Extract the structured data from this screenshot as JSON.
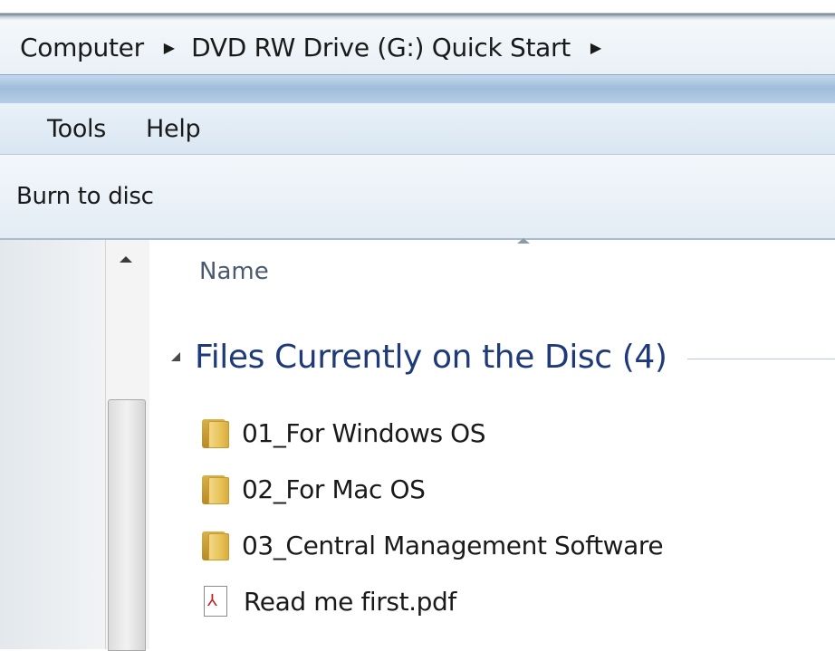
{
  "address_bar": {
    "crumbs": [
      "Computer",
      "DVD RW Drive (G:) Quick Start"
    ]
  },
  "menu_bar": {
    "tools_label": "Tools",
    "help_label": "Help"
  },
  "command_bar": {
    "burn_label": "Burn to disc"
  },
  "file_view": {
    "column_name": "Name",
    "group_title": "Files Currently on the Disc (4)",
    "items": [
      {
        "name": "01_For Windows OS",
        "icon": "folder-icon"
      },
      {
        "name": "02_For Mac OS",
        "icon": "folder-icon"
      },
      {
        "name": "03_Central Management Software",
        "icon": "folder-icon"
      },
      {
        "name": "Read me first.pdf",
        "icon": "pdf-file-icon"
      }
    ]
  },
  "colors": {
    "group_title": "#1e3a78",
    "band": "#9fbddb"
  }
}
